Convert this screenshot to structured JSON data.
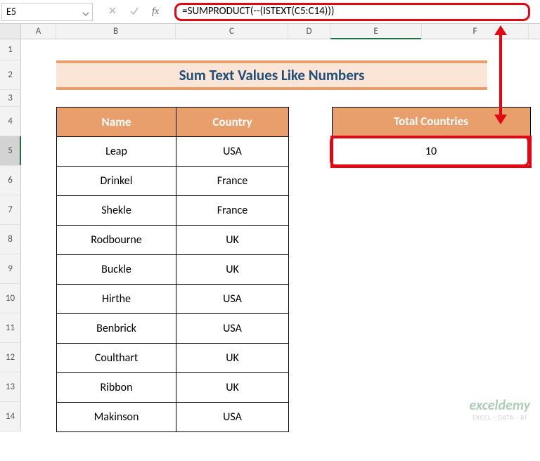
{
  "nameBox": "E5",
  "formula": "=SUMPRODUCT(--(ISTEXT(C5:C14)))",
  "columns": {
    "a": "A",
    "b": "B",
    "c": "C",
    "d": "D",
    "e": "E",
    "f": "F"
  },
  "rows": [
    "1",
    "2",
    "3",
    "4",
    "5",
    "6",
    "7",
    "8",
    "9",
    "10",
    "11",
    "12",
    "13",
    "14"
  ],
  "title": "Sum Text Values Like Numbers",
  "headers": {
    "name": "Name",
    "country": "Country",
    "total": "Total Countries"
  },
  "data": [
    {
      "name": "Leap",
      "country": "USA"
    },
    {
      "name": "Drinkel",
      "country": "France"
    },
    {
      "name": "Shekle",
      "country": "France"
    },
    {
      "name": "Rodbourne",
      "country": "UK"
    },
    {
      "name": "Buckle",
      "country": "UK"
    },
    {
      "name": "Hirthe",
      "country": "USA"
    },
    {
      "name": "Benbrick",
      "country": "USA"
    },
    {
      "name": "Coulthart",
      "country": "UK"
    },
    {
      "name": "Ribbon",
      "country": "UK"
    },
    {
      "name": "Makinson",
      "country": "USA"
    }
  ],
  "result": "10",
  "watermark": {
    "line1": "exceldemy",
    "line2": "EXCEL · DATA · BI"
  }
}
